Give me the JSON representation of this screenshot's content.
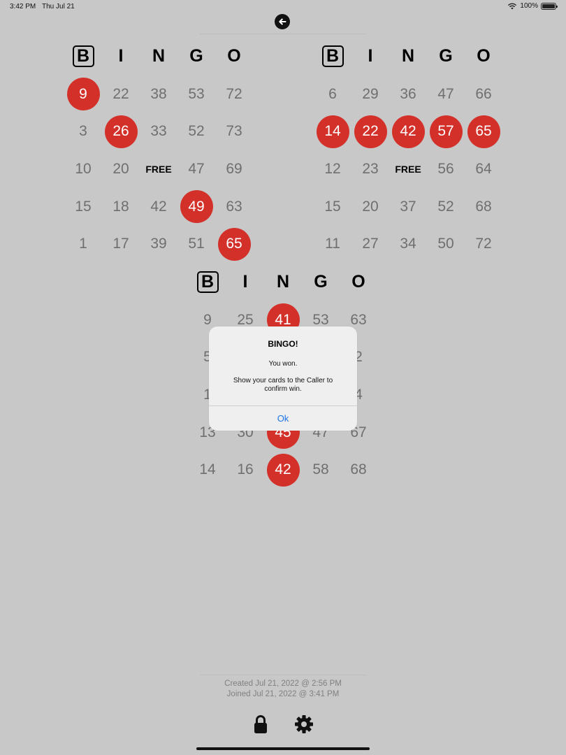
{
  "status": {
    "time": "3:42 PM",
    "date": "Thu Jul 21",
    "battery": "100%"
  },
  "colors": {
    "marked": "#d3302a",
    "background": "#c8c8c8",
    "link": "#1a73e8"
  },
  "headers": [
    "B",
    "I",
    "N",
    "G",
    "O"
  ],
  "free_label": "FREE",
  "cards": [
    {
      "rows": [
        [
          "9",
          "22",
          "38",
          "53",
          "72"
        ],
        [
          "3",
          "26",
          "33",
          "52",
          "73"
        ],
        [
          "10",
          "20",
          "FREE",
          "47",
          "69"
        ],
        [
          "15",
          "18",
          "42",
          "49",
          "63"
        ],
        [
          "1",
          "17",
          "39",
          "51",
          "65"
        ]
      ],
      "marked": [
        [
          0,
          0
        ],
        [
          1,
          1
        ],
        [
          3,
          3
        ],
        [
          4,
          4
        ]
      ]
    },
    {
      "rows": [
        [
          "6",
          "29",
          "36",
          "47",
          "66"
        ],
        [
          "14",
          "22",
          "42",
          "57",
          "65"
        ],
        [
          "12",
          "23",
          "FREE",
          "56",
          "64"
        ],
        [
          "15",
          "20",
          "37",
          "52",
          "68"
        ],
        [
          "11",
          "27",
          "34",
          "50",
          "72"
        ]
      ],
      "marked": [
        [
          1,
          0
        ],
        [
          1,
          1
        ],
        [
          1,
          2
        ],
        [
          1,
          3
        ],
        [
          1,
          4
        ]
      ]
    },
    {
      "rows": [
        [
          "9",
          "25",
          "41",
          "53",
          "63"
        ],
        [
          "5",
          "",
          "",
          "",
          "2"
        ],
        [
          "1",
          "",
          "",
          "",
          "4"
        ],
        [
          "13",
          "30",
          "45",
          "47",
          "67"
        ],
        [
          "14",
          "16",
          "42",
          "58",
          "68"
        ]
      ],
      "marked": [
        [
          0,
          2
        ],
        [
          3,
          2
        ],
        [
          4,
          2
        ]
      ]
    }
  ],
  "dialog": {
    "title": "BINGO!",
    "message1": "You won.",
    "message2": "Show your cards to the Caller to confirm win.",
    "button": "Ok"
  },
  "footer": {
    "created": "Created Jul 21, 2022 @ 2:56 PM",
    "joined": "Joined Jul 21, 2022 @ 3:41 PM"
  },
  "icons": {
    "back": "arrow-left-icon",
    "lock": "lock-icon",
    "settings": "gear-icon"
  }
}
